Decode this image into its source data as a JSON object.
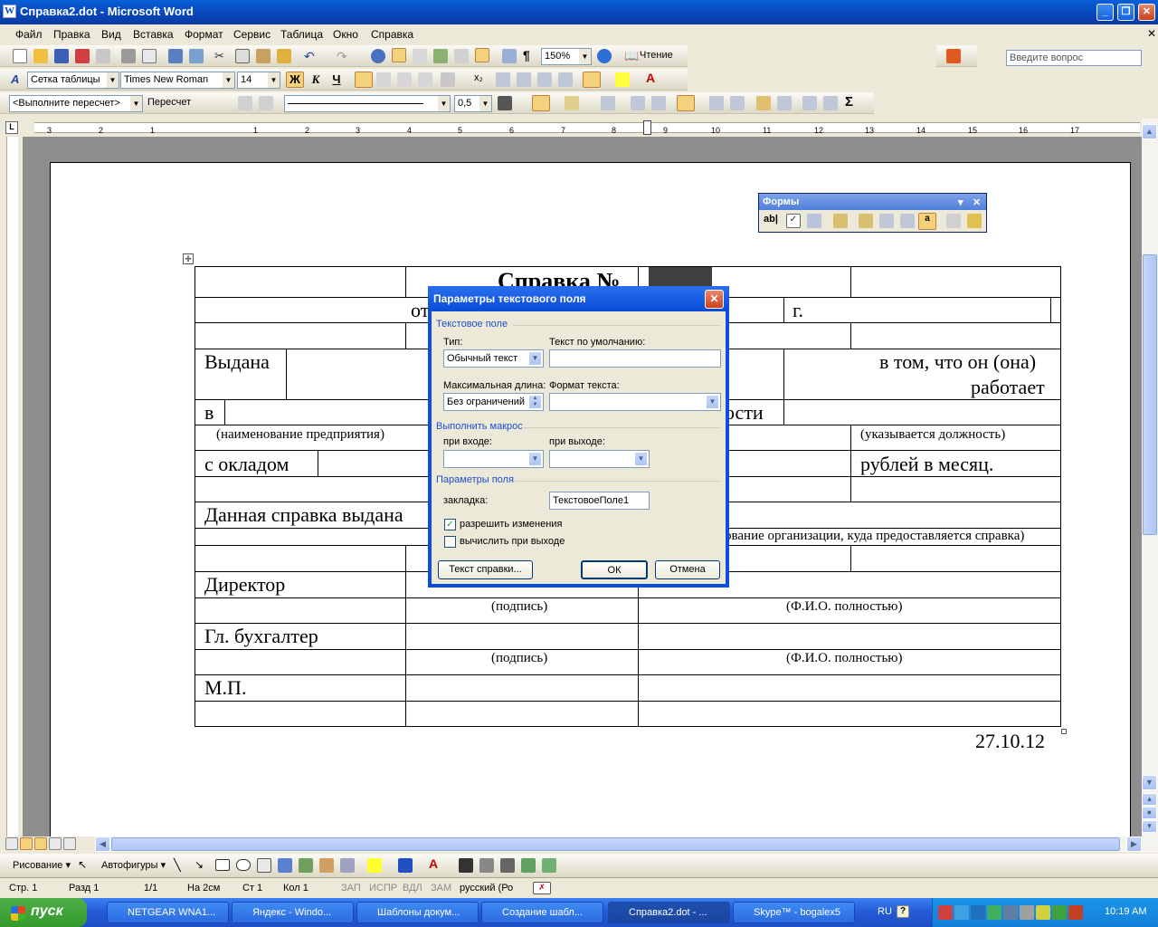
{
  "window": {
    "title": "Справка2.dot - Microsoft Word",
    "min": "_",
    "max": "❐",
    "close": "✕"
  },
  "menu": [
    "Файл",
    "Правка",
    "Вид",
    "Вставка",
    "Формат",
    "Сервис",
    "Таблица",
    "Окно",
    "Справка"
  ],
  "ask_placeholder": "Введите вопрос",
  "toolbar": {
    "zoom": "150%",
    "read_label": "Чтение",
    "style": "Сетка таблицы",
    "font": "Times New Roman",
    "size": "14",
    "bold": "Ж",
    "italic": "К",
    "underline": "Ч",
    "macro_combo": "<Выполните пересчет>",
    "recalc": "Пересчет",
    "line_weight": "0,5",
    "sigma": "Σ"
  },
  "ruler_numbers": [
    "3",
    "2",
    "1",
    "1",
    "2",
    "3",
    "4",
    "5",
    "6",
    "7",
    "8",
    "9",
    "10",
    "11",
    "12",
    "13",
    "14",
    "15",
    "16",
    "17"
  ],
  "forms_toolbar": {
    "title": "Формы"
  },
  "document": {
    "title": "Справка №",
    "from": "от",
    "g": "г.",
    "issued": "Выдана",
    "in_that": "в том, что он (она)",
    "works": "работает",
    "v": "в",
    "osti": "ости",
    "org_name": "(наименование предприятия)",
    "position": "(указывается должность)",
    "salary": "с окладом",
    "rub": "рублей в месяц.",
    "given": "Данная справка выдана",
    "org_where": "ование организации, куда предоставляется справка)",
    "director": "Директор",
    "sign": "(подпись)",
    "fio": "(Ф.И.О. полностью)",
    "accountant": "Гл. бухгалтер",
    "mp": "М.П.",
    "date": "27.10.12"
  },
  "dialog": {
    "title": "Параметры текстового поля",
    "group_text": "Текстовое поле",
    "type_label": "Тип:",
    "type_value": "Обычный текст",
    "default_label": "Текст по умолчанию:",
    "default_value": "",
    "maxlen_label": "Максимальная длина:",
    "maxlen_value": "Без ограничений",
    "format_label": "Формат текста:",
    "format_value": "",
    "group_macro": "Выполнить макрос",
    "on_entry": "при входе:",
    "on_exit": "при выходе:",
    "group_params": "Параметры поля",
    "bookmark_label": "закладка:",
    "bookmark_value": "ТекстовоеПоле1",
    "allow_changes": "разрешить изменения",
    "allow_changes_checked": true,
    "calc_on_exit": "вычислить при выходе",
    "calc_on_exit_checked": false,
    "help_text_btn": "Текст справки...",
    "ok": "ОК",
    "cancel": "Отмена"
  },
  "drawbar": {
    "drawing": "Рисование ▾",
    "autoshapes": "Автофигуры ▾"
  },
  "status": {
    "page": "Стр. 1",
    "section": "Разд 1",
    "pages": "1/1",
    "at": "На 2см",
    "line": "Ст 1",
    "col": "Кол 1",
    "rec": "ЗАП",
    "trk": "ИСПР",
    "ext": "ВДЛ",
    "ovr": "ЗАМ",
    "lang": "русский (Ро"
  },
  "taskbar": {
    "start": "пуск",
    "tasks": [
      "NETGEAR WNA1...",
      "Яндекс - Windo...",
      "Шаблоны докум...",
      "Создание шабл...",
      "Справка2.dot - ...",
      "Skype™ - bogalex5"
    ],
    "lang": "RU",
    "time": "10:19 AM"
  },
  "colors": {
    "accent": "#0a4bd6",
    "taskbar": "#245edb",
    "start": "#3c9d34"
  }
}
